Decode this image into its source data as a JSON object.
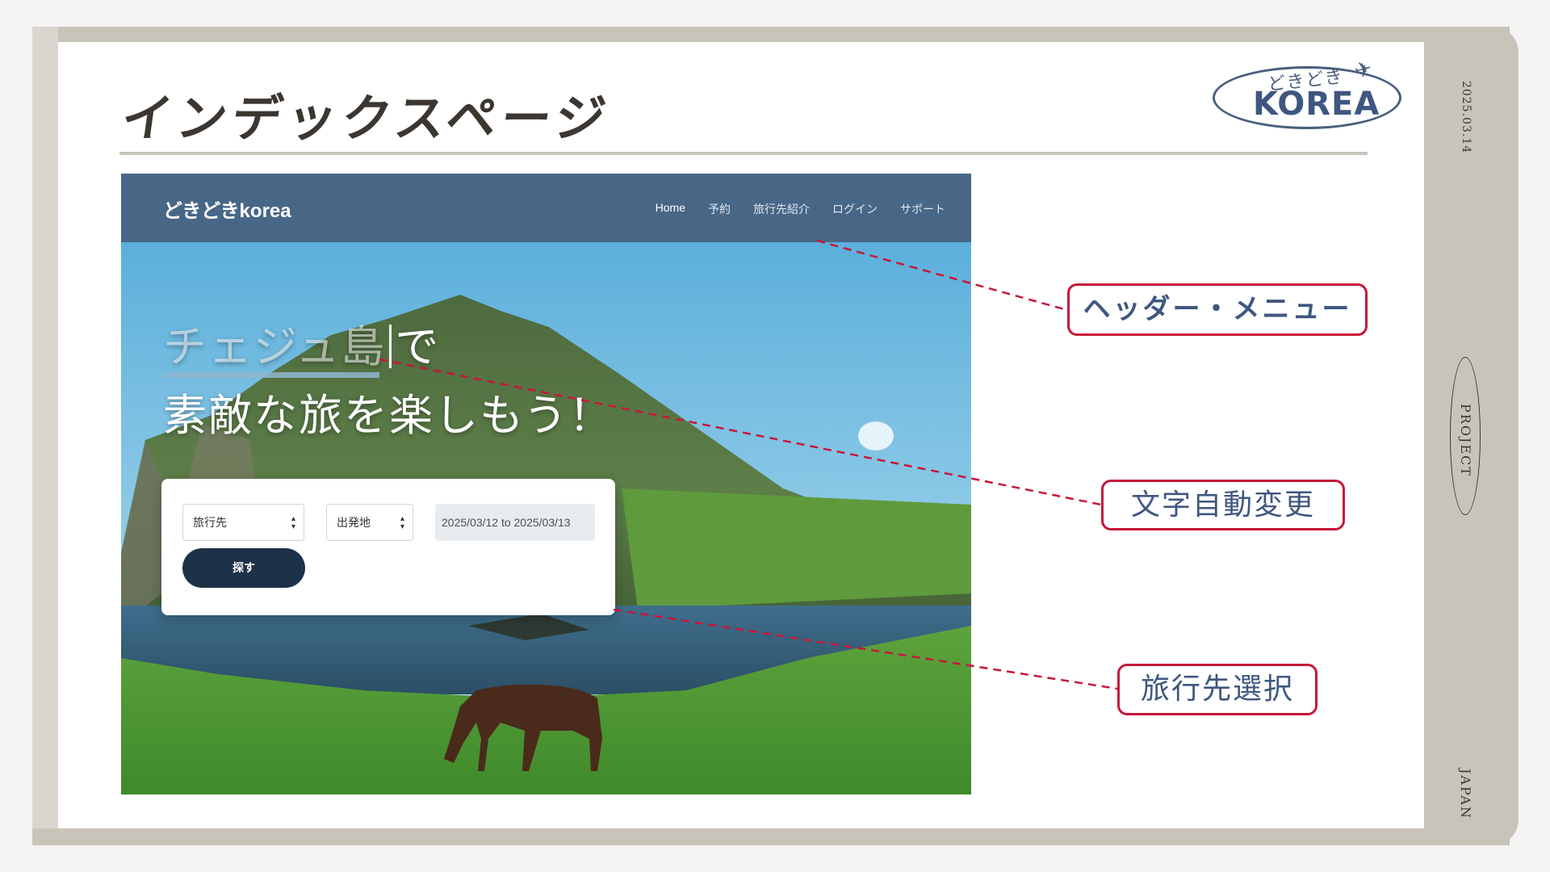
{
  "slide": {
    "title": "インデックスページ",
    "date": "2025.03.14",
    "side_label_project": "PROJECT",
    "side_label_country": "JAPAN",
    "logo": {
      "top_text": "どきどき",
      "main_text": "KOREA"
    }
  },
  "screenshot": {
    "header": {
      "site_name": "どきどきkorea",
      "nav": [
        "Home",
        "予約",
        "旅行先紹介",
        "ログイン",
        "サポート"
      ]
    },
    "hero": {
      "line1_typed": "チェジュ島",
      "line1_rest": "で",
      "line2": "素敵な旅を楽しもう！"
    },
    "search": {
      "destination_value": "旅行先",
      "origin_value": "出発地",
      "date_range": "2025/03/12 to 2025/03/13",
      "button_label": "探す"
    }
  },
  "annotations": {
    "header_menu": "ヘッダー・メニュー",
    "auto_text": "文字自動変更",
    "destination_select": "旅行先選択"
  },
  "colors": {
    "frame": "#c9c4ba",
    "header_bg": "#486787",
    "button_bg": "#1d3149",
    "callout_border": "#c8173a",
    "callout_text": "#3f5780"
  }
}
